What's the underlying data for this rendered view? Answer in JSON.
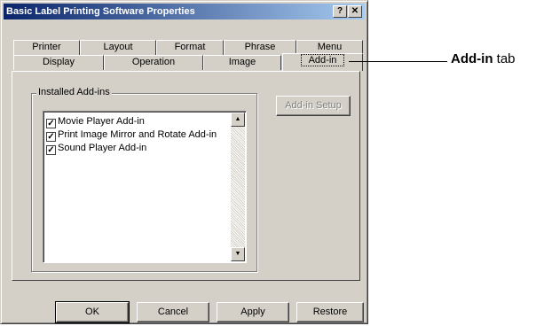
{
  "dialog": {
    "title": "Basic Label Printing Software Properties",
    "help_label": "?",
    "close_label": "✕"
  },
  "tabs": {
    "row1": [
      "Printer",
      "Layout",
      "Format",
      "Phrase",
      "Menu"
    ],
    "row2": [
      "Display",
      "Operation",
      "Image",
      "Add-in"
    ],
    "active": "Add-in"
  },
  "addins": {
    "group_label": "Installed Add-ins",
    "setup_button": "Add-in Setup",
    "items": [
      {
        "label": "Movie Player Add-in",
        "checked": true
      },
      {
        "label": "Print Image Mirror and Rotate Add-in",
        "checked": true
      },
      {
        "label": "Sound Player Add-in",
        "checked": true
      }
    ]
  },
  "buttons": {
    "ok": "OK",
    "cancel": "Cancel",
    "apply": "Apply",
    "restore": "Restore"
  },
  "callout": {
    "bold": "Add-in",
    "rest": " tab"
  },
  "icons": [
    "help-icon",
    "close-icon",
    "checkbox-check-icon",
    "scroll-up-arrow-icon",
    "scroll-down-arrow-icon"
  ]
}
